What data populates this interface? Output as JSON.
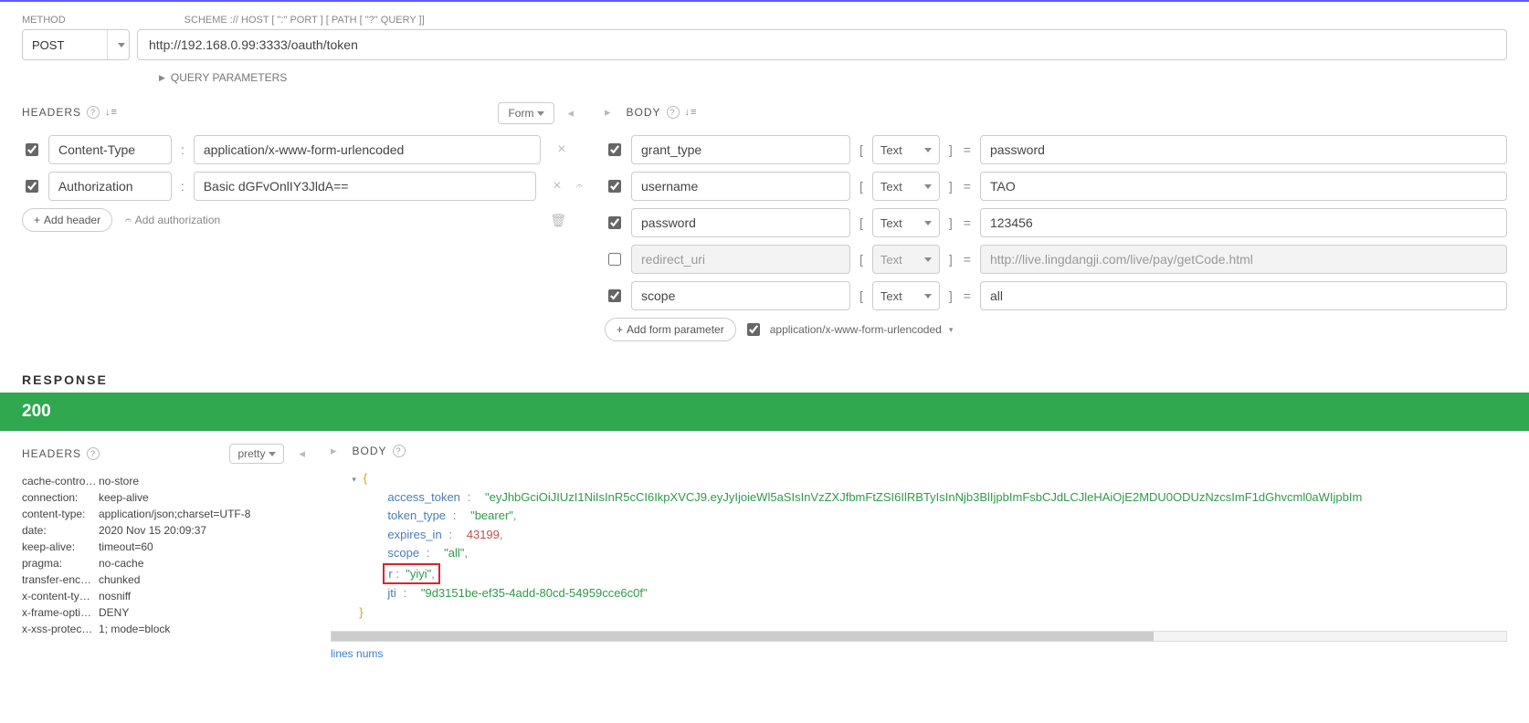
{
  "labels": {
    "method": "METHOD",
    "url_hint": "SCHEME :// HOST [ \":\" PORT ] [ PATH [ \"?\" QUERY ]]",
    "query_params": "QUERY PARAMETERS",
    "headers": "HEADERS",
    "body": "BODY",
    "form": "Form",
    "add_header": "Add header",
    "add_auth": "Add authorization",
    "add_form_param": "Add form parameter",
    "response": "RESPONSE",
    "pretty": "pretty",
    "lines_nums": "lines nums"
  },
  "request": {
    "method": "POST",
    "url": "http://192.168.0.99:3333/oauth/token"
  },
  "headers": [
    {
      "enabled": true,
      "name": "Content-Type",
      "value": "application/x-www-form-urlencoded",
      "hasKey": false
    },
    {
      "enabled": true,
      "name": "Authorization",
      "value": "Basic dGFvOnlIY3JldA==",
      "hasKey": true
    }
  ],
  "body_params": [
    {
      "enabled": true,
      "name": "grant_type",
      "type": "Text",
      "value": "password"
    },
    {
      "enabled": true,
      "name": "username",
      "type": "Text",
      "value": "TAO"
    },
    {
      "enabled": true,
      "name": "password",
      "type": "Text",
      "value": "123456"
    },
    {
      "enabled": false,
      "name": "redirect_uri",
      "type": "Text",
      "value": "http://live.lingdangji.com/live/pay/getCode.html"
    },
    {
      "enabled": true,
      "name": "scope",
      "type": "Text",
      "value": "all"
    }
  ],
  "body_content_type": "application/x-www-form-urlencoded",
  "response": {
    "status": "200",
    "headers": [
      {
        "name": "cache-contro…",
        "value": "no-store"
      },
      {
        "name": "connection:",
        "value": "keep-alive"
      },
      {
        "name": "content-type:",
        "value": "application/json;charset=UTF-8"
      },
      {
        "name": "date:",
        "value": "2020 Nov 15 20:09:37"
      },
      {
        "name": "keep-alive:",
        "value": "timeout=60"
      },
      {
        "name": "pragma:",
        "value": "no-cache"
      },
      {
        "name": "transfer-enc…",
        "value": "chunked"
      },
      {
        "name": "x-content-ty…",
        "value": "nosniff"
      },
      {
        "name": "x-frame-opti…",
        "value": "DENY"
      },
      {
        "name": "x-xss-protec…",
        "value": "1; mode=block"
      }
    ],
    "json": {
      "access_token": "\"eyJhbGciOiJIUzI1NiIsInR5cCI6IkpXVCJ9.eyJyIjoieWl5aSIsInVzZXJfbmFtZSI6IlRBTyIsInNjb3BlIjpbImFsbCJdLCJleHAiOjE2MDU0ODUzNzcsImF1dGhvcml0aWIjpbIm",
      "token_type": "\"bearer\"",
      "expires_in": "43199",
      "scope": "\"all\"",
      "r": "\"yiyi\"",
      "jti": "\"9d3151be-ef35-4add-80cd-54959cce6c0f\""
    }
  }
}
